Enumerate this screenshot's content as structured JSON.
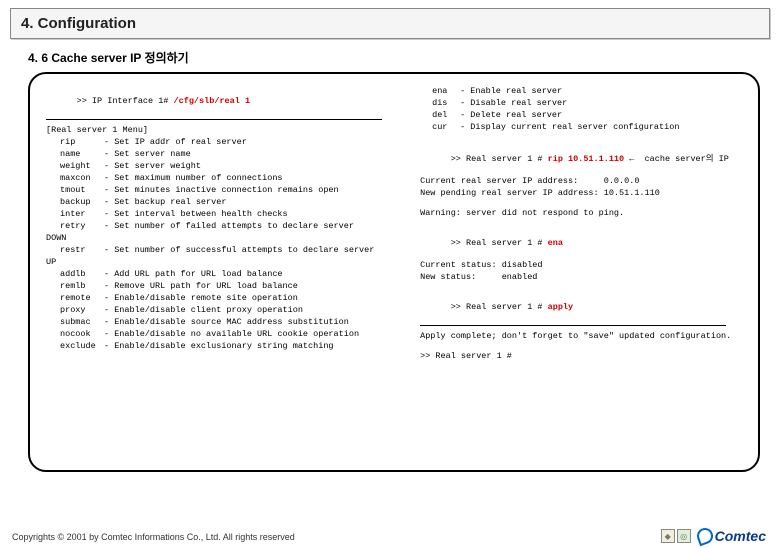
{
  "header": {
    "title": "4. Configuration"
  },
  "subheader": {
    "title": "4. 6 Cache server IP 정의하기"
  },
  "prompt": {
    "prefix": ">> IP Interface 1# ",
    "cmd": "/cfg/slb/real 1"
  },
  "menu_title": "[Real server 1 Menu]",
  "menu": [
    {
      "k": "rip",
      "d": "- Set IP addr of real server"
    },
    {
      "k": "name",
      "d": "- Set server name"
    },
    {
      "k": "weight",
      "d": "- Set server weight"
    },
    {
      "k": "maxcon",
      "d": "- Set maximum number of connections"
    },
    {
      "k": "tmout",
      "d": "- Set minutes inactive connection remains open"
    },
    {
      "k": "backup",
      "d": "- Set backup real server"
    },
    {
      "k": "inter",
      "d": "- Set interval between health checks"
    },
    {
      "k": "retry",
      "d": "- Set number of failed attempts to declare server"
    }
  ],
  "down_label": "DOWN",
  "menu_down": [
    {
      "k": "restr",
      "d": "- Set number of successful attempts to declare server"
    }
  ],
  "up_label": "UP",
  "menu_up": [
    {
      "k": "addlb",
      "d": "- Add URL path for URL load balance"
    },
    {
      "k": "remlb",
      "d": "- Remove URL path for URL load balance"
    },
    {
      "k": "remote",
      "d": "- Enable/disable remote site operation"
    },
    {
      "k": "proxy",
      "d": "- Enable/disable client proxy operation"
    },
    {
      "k": "submac",
      "d": "- Enable/disable source MAC address substitution"
    },
    {
      "k": "nocook",
      "d": "- Enable/disable no available URL cookie operation"
    },
    {
      "k": "exclude",
      "d": "- Enable/disable exclusionary string matching"
    }
  ],
  "rmenu": [
    {
      "k": "ena",
      "d": "- Enable real server"
    },
    {
      "k": "dis",
      "d": "- Disable real server"
    },
    {
      "k": "del",
      "d": "- Delete real server"
    },
    {
      "k": "cur",
      "d": "- Display current real server configuration"
    }
  ],
  "r1": {
    "prefix": ">> Real server 1 # ",
    "cmd": "rip 10.51.1.110",
    "note": " ←  cache server의 IP"
  },
  "r1a": "Current real server IP address:     0.0.0.0",
  "r1b": "New pending real server IP address: 10.51.1.110",
  "r2": "Warning: server did not respond to ping.",
  "r3": {
    "prefix": ">> Real server 1 # ",
    "cmd": "ena"
  },
  "r3a": "Current status: disabled",
  "r3b": "New status:     enabled",
  "r4": {
    "prefix": ">> Real server 1 # ",
    "cmd": "apply"
  },
  "r4a": "Apply complete; don't forget to \"save\" updated configuration.",
  "r5": ">> Real server 1 #",
  "footer": "Copyrights © 2001 by Comtec Informations Co., Ltd. All rights reserved",
  "brand": "Comtec"
}
